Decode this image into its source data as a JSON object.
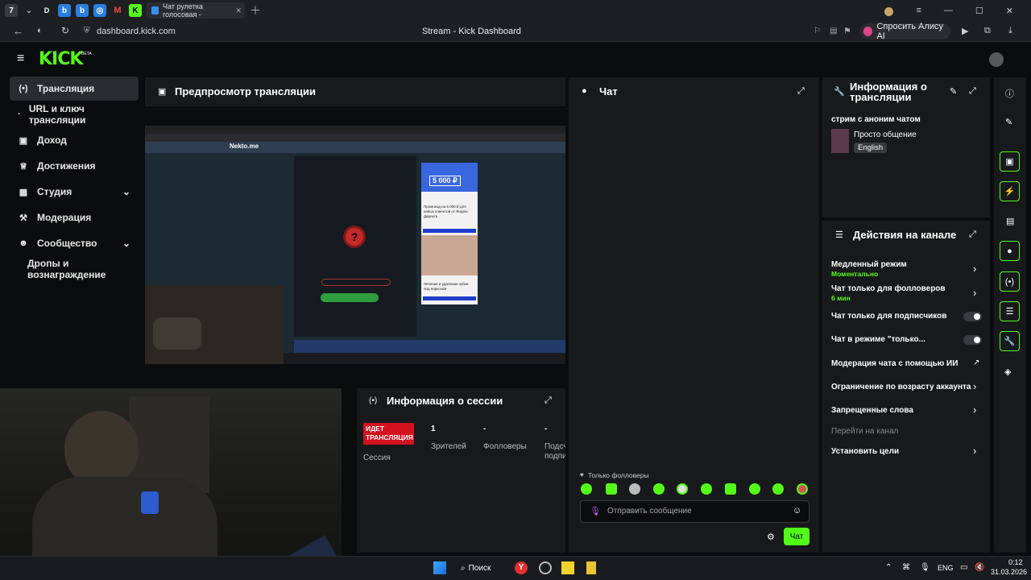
{
  "browser": {
    "tab_title": "Чат рулетка голосовая -",
    "url": "dashboard.kick.com",
    "page_title": "Stream - Kick Dashboard",
    "ask_alice": "Спросить Алису AI"
  },
  "kick": {
    "logo": "KICK",
    "beta": "BETA"
  },
  "sidebar": {
    "items": [
      {
        "label": "Трансляция"
      },
      {
        "label": "URL и ключ трансляции"
      },
      {
        "label": "Доход"
      },
      {
        "label": "Достижения"
      },
      {
        "label": "Студия"
      },
      {
        "label": "Модерация"
      },
      {
        "label": "Сообщество"
      },
      {
        "label": "Дропы и вознаграждение"
      }
    ]
  },
  "preview": {
    "title": "Предпросмотр трансляции",
    "inner_site": "Nekto.me",
    "inner_ad_amount": "5 000 ₽",
    "inner_ad_text": "Промокод на 5 000 ₽ для новых клиентов от Яндекс Директа",
    "inner_ad2_text": "Лечение и удаление зубов под наркозом"
  },
  "chat": {
    "title": "Чат",
    "followers_only": "Только фолловеры",
    "placeholder": "Отправить сообщение",
    "send": "Чат"
  },
  "stream_info": {
    "title": "Информация о трансляции",
    "stream_title": "стрим с аноним чатом",
    "category": "Просто общение",
    "language": "English"
  },
  "session": {
    "title": "Информация о сессии",
    "live_badge": "ИДЕТ ТРАНСЛЯЦИЯ",
    "session_label": "Сессия",
    "viewers_value": "1",
    "viewers_label": "Зрителей",
    "followers_value": "-",
    "followers_label": "Фолловеры",
    "subs_value": "-",
    "subs_label": "Подсч подпи"
  },
  "actions": {
    "title": "Действия на канале",
    "slow_mode": "Медленный режим",
    "slow_mode_value": "Моментально",
    "followers_chat": "Чат только для фолловеров",
    "followers_chat_value": "6 мин",
    "subs_chat": "Чат только для подписчиков",
    "mode_chat": "Чат в режиме \"только...",
    "ai_mod": "Модерация чата с помощью ИИ",
    "age_limit": "Ограничение по возрасту аккаунта",
    "banned_words": "Запрещенные слова",
    "goto_channel": "Перейти на канал",
    "set_goals": "Установить цели"
  },
  "taskbar": {
    "search": "Поиск",
    "lang": "ENG",
    "time": "0:12",
    "date": "31.03.2026"
  },
  "colors": {
    "accent": "#53fc18",
    "live": "#d4111f",
    "panel": "#18191b"
  }
}
